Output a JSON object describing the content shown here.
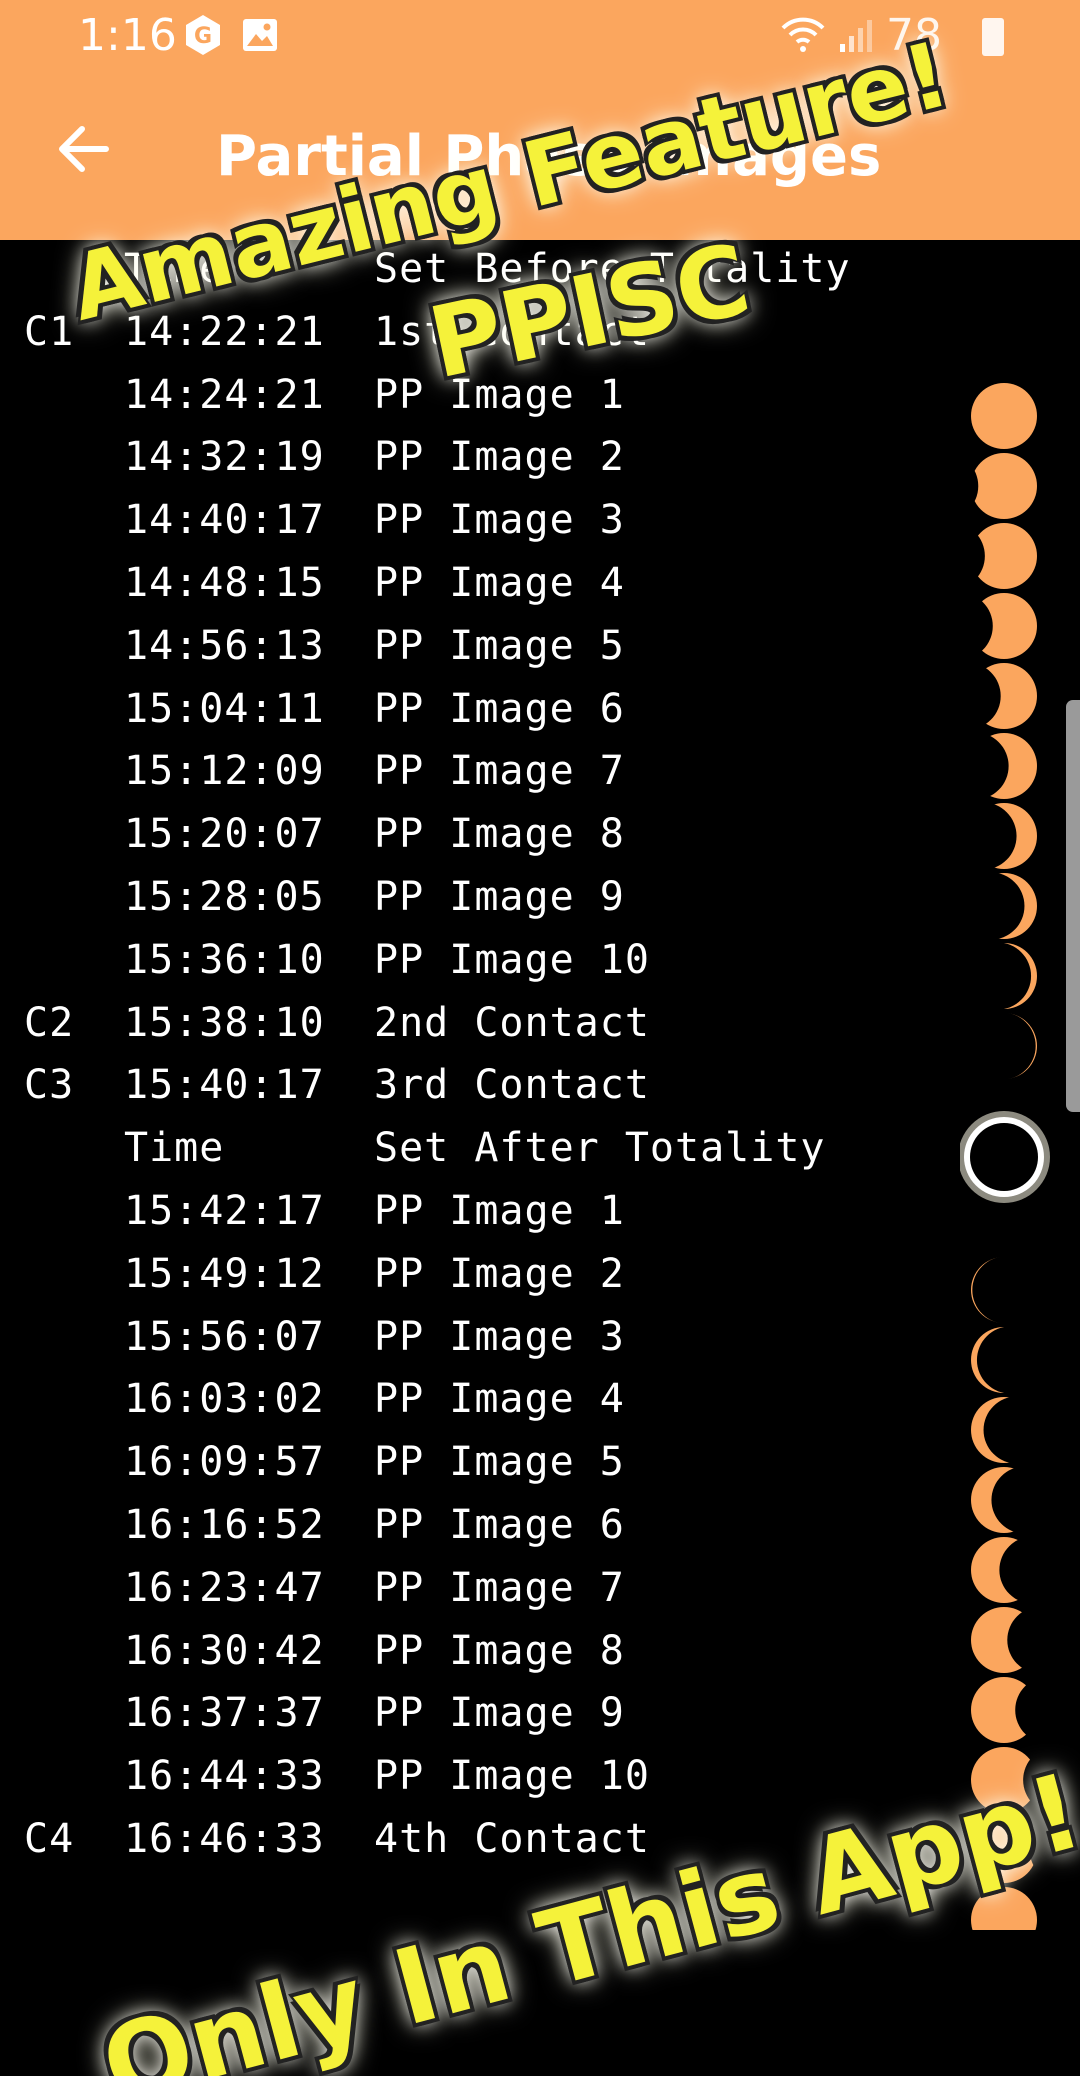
{
  "status_bar": {
    "time": "1:16",
    "battery": "78"
  },
  "app_bar": {
    "title": "Partial Phase Images",
    "back_icon": "arrow-left-icon"
  },
  "rows": [
    {
      "code": "",
      "time": "Time",
      "label": "Set Before Totality"
    },
    {
      "code": "C1",
      "time": "14:22:21",
      "label": "1st Contact"
    },
    {
      "code": "",
      "time": "14:24:21",
      "label": "PP Image 1"
    },
    {
      "code": "",
      "time": "14:32:19",
      "label": "PP Image 2"
    },
    {
      "code": "",
      "time": "14:40:17",
      "label": "PP Image 3"
    },
    {
      "code": "",
      "time": "14:48:15",
      "label": "PP Image 4"
    },
    {
      "code": "",
      "time": "14:56:13",
      "label": "PP Image 5"
    },
    {
      "code": "",
      "time": "15:04:11",
      "label": "PP Image 6"
    },
    {
      "code": "",
      "time": "15:12:09",
      "label": "PP Image 7"
    },
    {
      "code": "",
      "time": "15:20:07",
      "label": "PP Image 8"
    },
    {
      "code": "",
      "time": "15:28:05",
      "label": "PP Image 9"
    },
    {
      "code": "",
      "time": "15:36:10",
      "label": "PP Image 10"
    },
    {
      "code": "C2",
      "time": "15:38:10",
      "label": "2nd Contact"
    },
    {
      "code": "C3",
      "time": "15:40:17",
      "label": "3rd Contact"
    },
    {
      "code": "",
      "time": "Time",
      "label": "Set After Totality"
    },
    {
      "code": "",
      "time": "15:42:17",
      "label": "PP Image 1"
    },
    {
      "code": "",
      "time": "15:49:12",
      "label": "PP Image 2"
    },
    {
      "code": "",
      "time": "15:56:07",
      "label": "PP Image 3"
    },
    {
      "code": "",
      "time": "16:03:02",
      "label": "PP Image 4"
    },
    {
      "code": "",
      "time": "16:09:57",
      "label": "PP Image 5"
    },
    {
      "code": "",
      "time": "16:16:52",
      "label": "PP Image 6"
    },
    {
      "code": "",
      "time": "16:23:47",
      "label": "PP Image 7"
    },
    {
      "code": "",
      "time": "16:30:42",
      "label": "PP Image 8"
    },
    {
      "code": "",
      "time": "16:37:37",
      "label": "PP Image 9"
    },
    {
      "code": "",
      "time": "16:44:33",
      "label": "PP Image 10"
    },
    {
      "code": "C4",
      "time": "16:46:33",
      "label": "4th Contact"
    }
  ],
  "promo": {
    "line1": "Amazing Feature!",
    "line2": "PPISC",
    "line3": "Only In This App!"
  },
  "colors": {
    "app_bar": "#FBA65E",
    "sun": "#FBA65E",
    "promo_text": "#F5F23A"
  },
  "eclipse_phases_before": [
    0,
    0.1,
    0.2,
    0.32,
    0.44,
    0.56,
    0.68,
    0.8,
    0.9,
    0.97
  ],
  "eclipse_phases_after": [
    0.97,
    0.9,
    0.8,
    0.68,
    0.56,
    0.44,
    0.32,
    0.2,
    0.1,
    0
  ]
}
